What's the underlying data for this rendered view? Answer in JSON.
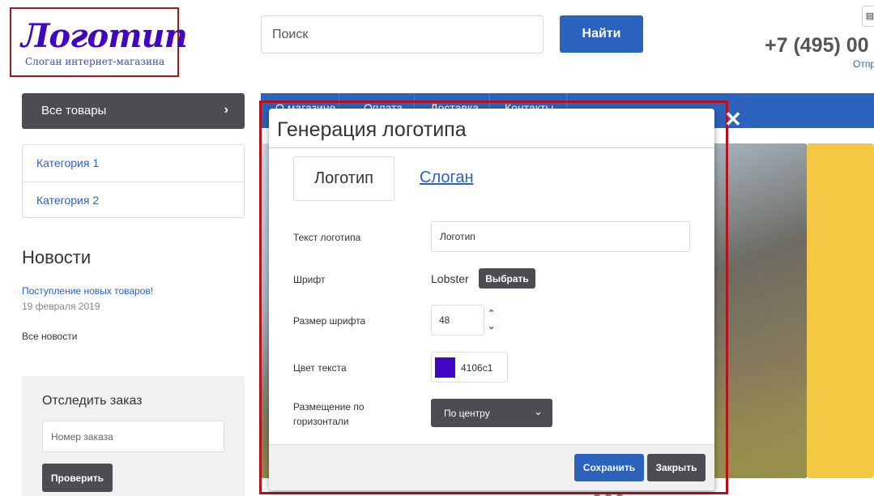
{
  "header": {
    "logo_text": "Логотип",
    "logo_slogan": "Слоган интернет-магазина",
    "search_placeholder": "Поиск",
    "search_button": "Найти",
    "phone": "+7 (495) 00",
    "callback_link": "Отпр"
  },
  "sidebar": {
    "all_products": "Все товары",
    "categories": [
      {
        "label": "Категория 1"
      },
      {
        "label": "Категория 2"
      }
    ],
    "news_title": "Новости",
    "news_items": [
      {
        "title": "Поступление новых товаров!",
        "date": "19 февраля 2019"
      }
    ],
    "all_news": "Все новости",
    "track": {
      "title": "Отследить заказ",
      "placeholder": "Номер заказа",
      "button": "Проверить"
    }
  },
  "nav": {
    "items": [
      {
        "label": "О магазине"
      },
      {
        "label": "Оплата"
      },
      {
        "label": "Доставка"
      },
      {
        "label": "Контакты"
      }
    ]
  },
  "modal": {
    "title": "Генерация логотипа",
    "tabs": [
      {
        "label": "Логотип",
        "active": true
      },
      {
        "label": "Слоган",
        "active": false
      }
    ],
    "fields": {
      "logo_text_label": "Текст логотипа",
      "logo_text_value": "Логотип",
      "font_label": "Шрифт",
      "font_value": "Lobster",
      "font_button": "Выбрать",
      "size_label": "Размер шрифта",
      "size_value": "48",
      "color_label": "Цвет текста",
      "color_value": "4106c1",
      "align_label_line1": "Размещение по",
      "align_label_line2": "горизонтали",
      "align_value": "По центру"
    },
    "save_button": "Сохранить",
    "close_button": "Закрыть"
  },
  "colors": {
    "brand_blue": "#2a62bd",
    "dark_button": "#4b4d52",
    "logo_color": "#4106c1",
    "highlight_red": "#b5131b"
  },
  "icons": {
    "chevron_right": "chevron-right-icon",
    "close": "close-icon",
    "cart": "cart-icon",
    "stepper": "stepper-icon",
    "dropdown": "chevron-down-icon"
  }
}
